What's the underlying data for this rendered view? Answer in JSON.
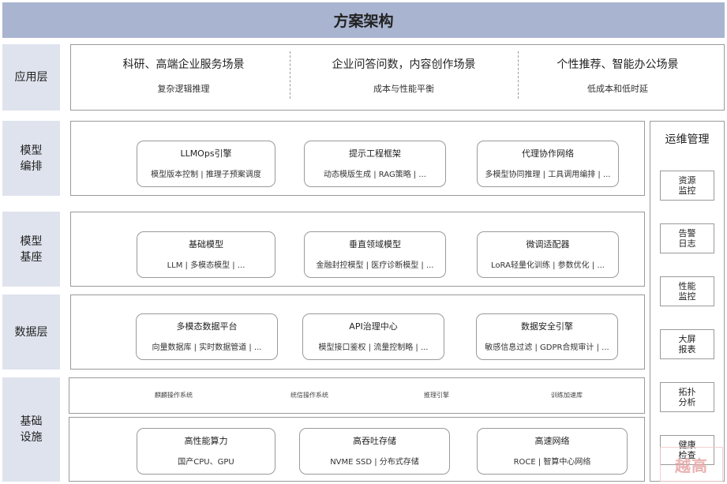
{
  "title": "方案架构",
  "layers": {
    "application": {
      "label": "应用层",
      "columns": [
        {
          "title": "科研、高端企业服务场景",
          "sub": "复杂逻辑推理"
        },
        {
          "title": "企业问答问数，内容创作场景",
          "sub": "成本与性能平衡"
        },
        {
          "title": "个性推荐、智能办公场景",
          "sub": "低成本和低时延"
        }
      ]
    },
    "orchestration": {
      "label": "模型\n编排",
      "cards": [
        {
          "title": "LLMOps引擎",
          "sub": "模型版本控制 | 推理子预案调度"
        },
        {
          "title": "提示工程框架",
          "sub": "动态模版生成 | RAG策略 | ..."
        },
        {
          "title": "代理协作网络",
          "sub": "多模型协同推理 | 工具调用编排 | ..."
        }
      ]
    },
    "foundation": {
      "label": "模型\n基座",
      "cards": [
        {
          "title": "基础模型",
          "sub": "LLM | 多模态模型 | ..."
        },
        {
          "title": "垂直领域模型",
          "sub": "金融封控模型 | 医疗诊断模型 | ..."
        },
        {
          "title": "微调适配器",
          "sub": "LoRA轻量化训练 | 参数优化 | ..."
        }
      ]
    },
    "data": {
      "label": "数据层",
      "cards": [
        {
          "title": "多模态数据平台",
          "sub": "向量数据库 | 实时数据管道 | ..."
        },
        {
          "title": "API治理中心",
          "sub": "模型接口鉴权 | 流量控制略 | ..."
        },
        {
          "title": "数据安全引擎",
          "sub": "敏感信息过滤 | GDPR合规审计 | ..."
        }
      ]
    },
    "infrastructure": {
      "label": "基础\n设施",
      "systems": [
        "麒麟操作系统",
        "统信操作系统",
        "推理引擎",
        "训练加速库"
      ],
      "cards": [
        {
          "title": "高性能算力",
          "sub": "国产CPU、GPU"
        },
        {
          "title": "高吞吐存储",
          "sub": "NVME SSD | 分布式存储"
        },
        {
          "title": "高速网络",
          "sub": "ROCE | 智算中心网络"
        }
      ]
    }
  },
  "ops": {
    "title": "运维管理",
    "items": [
      "资源\n监控",
      "告警\n日志",
      "性能\n监控",
      "大屏\n报表",
      "拓扑\n分析",
      "健康\n检查"
    ]
  },
  "watermark": "越高"
}
